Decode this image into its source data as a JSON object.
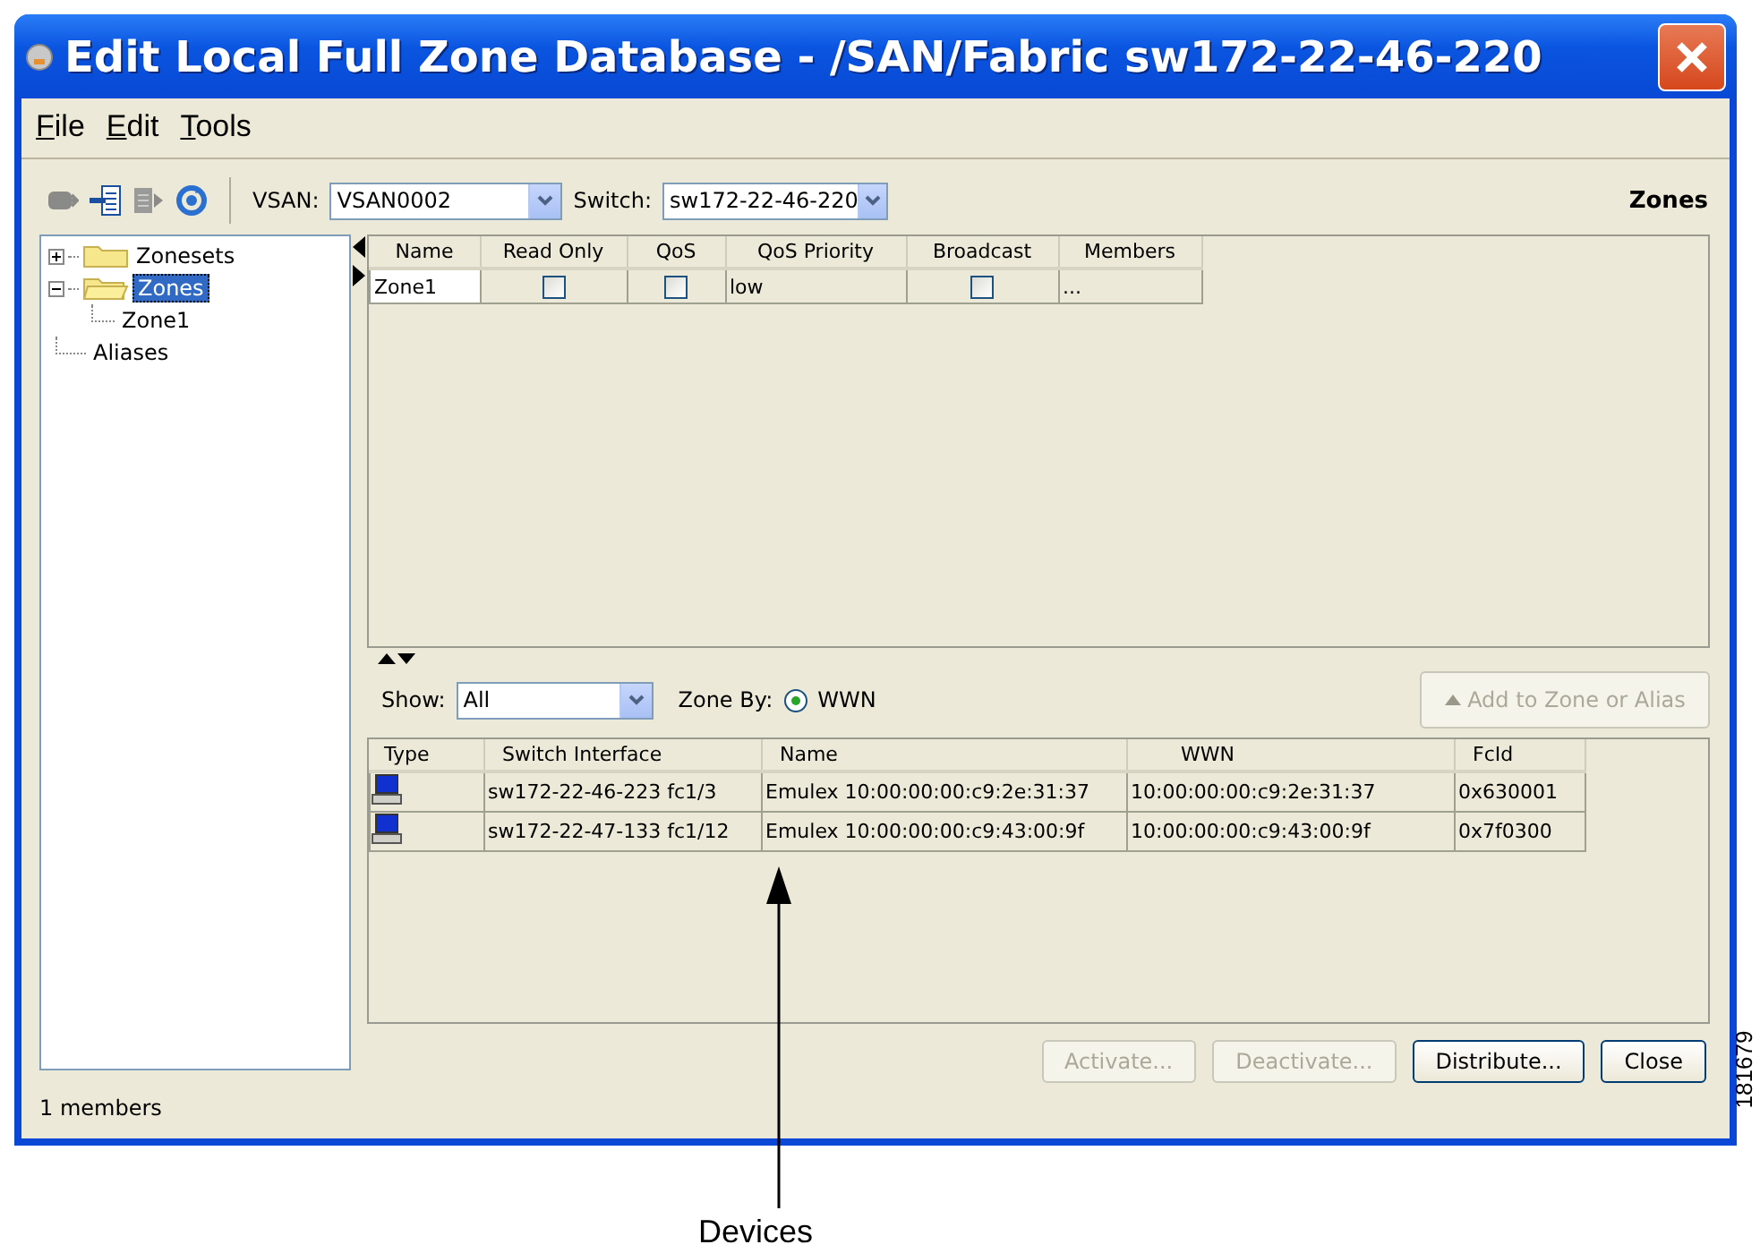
{
  "window": {
    "title": "Edit Local Full Zone Database - /SAN/Fabric sw172-22-46-220"
  },
  "menu": [
    {
      "label": "File"
    },
    {
      "label": "Edit"
    },
    {
      "label": "Tools"
    }
  ],
  "toolbar": {
    "vsan_label": "VSAN:",
    "vsan": "VSAN0002",
    "switch_label": "Switch:",
    "switch": "sw172-22-46-220",
    "section_title": "Zones"
  },
  "tree": [
    {
      "label": "Zonesets",
      "kind": "folder",
      "expanded": false,
      "selected": false
    },
    {
      "label": "Zones",
      "kind": "folder",
      "expanded": true,
      "selected": true,
      "children": [
        {
          "label": "Zone1",
          "kind": "leaf",
          "selected": false
        }
      ]
    },
    {
      "label": "Aliases",
      "kind": "leaf",
      "selected": false
    }
  ],
  "zones_table": {
    "columns": [
      "Name",
      "Read Only",
      "QoS",
      "QoS Priority",
      "Broadcast",
      "Members"
    ],
    "rows": [
      {
        "name": "Zone1",
        "read_only": false,
        "qos": false,
        "qos_priority": "low",
        "broadcast": false,
        "members": "..."
      }
    ]
  },
  "devices": {
    "show_label": "Show:",
    "show": "All",
    "zone_by_label": "Zone By:",
    "zone_by": [
      {
        "label": "WWN",
        "selected": true
      }
    ],
    "add_button": {
      "label": "Add to Zone or Alias",
      "disabled": true
    },
    "columns": [
      "Type",
      "Switch Interface",
      "Name",
      "WWN",
      "FcId"
    ],
    "rows": [
      {
        "switch_interface": "sw172-22-46-223 fc1/3",
        "name": "Emulex 10:00:00:00:c9:2e:31:37",
        "wwn": "10:00:00:00:c9:2e:31:37",
        "fcid": "0x630001"
      },
      {
        "switch_interface": "sw172-22-47-133 fc1/12",
        "name": "Emulex 10:00:00:00:c9:43:00:9f",
        "wwn": "10:00:00:00:c9:43:00:9f",
        "fcid": "0x7f0300"
      }
    ]
  },
  "buttons": [
    {
      "label": "Activate...",
      "disabled": true
    },
    {
      "label": "Deactivate...",
      "disabled": true
    },
    {
      "label": "Distribute...",
      "disabled": false
    },
    {
      "label": "Close",
      "disabled": false
    }
  ],
  "status_bar": "1 members",
  "callout": {
    "label": "Devices"
  },
  "figure_id": "181679"
}
